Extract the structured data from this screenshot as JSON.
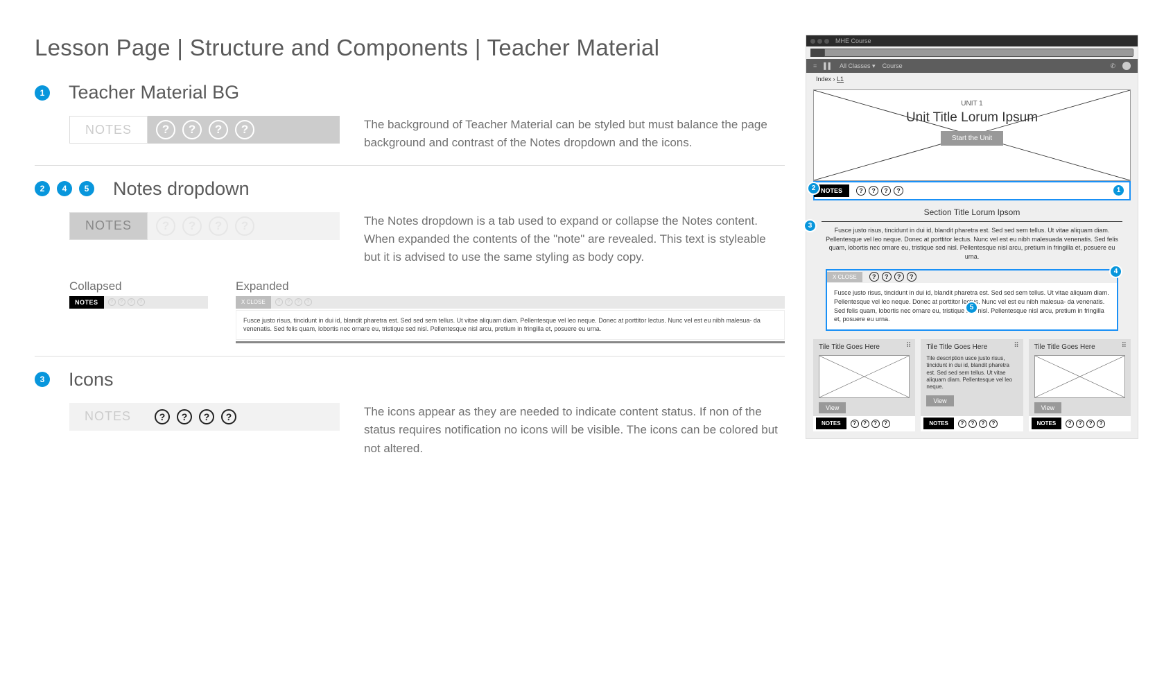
{
  "title": "Lesson Page |  Structure and Components | Teacher Material",
  "sections": [
    {
      "badges": [
        "1"
      ],
      "title": "Teacher Material BG",
      "notes_label": "NOTES",
      "desc": "The background of Teacher Material can be styled but must balance the page background and contrast of the Notes dropdown and the icons."
    },
    {
      "badges": [
        "2",
        "4",
        "5"
      ],
      "title": "Notes dropdown",
      "notes_label": "NOTES",
      "desc": "The Notes dropdown is a tab used to expand or collapse the Notes content. When expanded the contents of the \"note\" are revealed. This text is styleable but it is advised to use the same styling as body copy.",
      "collapsed_label": "Collapsed",
      "expanded_label": "Expanded",
      "mini_notes": "NOTES",
      "mini_close": "X  CLOSE",
      "mini_body": "Fusce justo risus, tincidunt in dui id, blandit pharetra est. Sed sed sem tellus. Ut vitae aliquam diam. Pellentesque vel leo neque. Donec at porttitor lectus. Nunc vel est eu nibh malesua- da venenatis. Sed felis quam, lobortis nec ornare eu, tristique sed nisl. Pellentesque nisl arcu, pretium in fringilla et, posuere eu urna."
    },
    {
      "badges": [
        "3"
      ],
      "title": "Icons",
      "notes_label": "NOTES",
      "desc": "The icons appear as they are needed to indicate content status. If non of the status requires notification no icons will be visible. The icons can be colored but not altered."
    }
  ],
  "mock": {
    "app_title": "MHE Course",
    "toolbar": {
      "classes": "All Classes  ▾",
      "course": "Course"
    },
    "crumb_index": "Index",
    "crumb_l1": "L1",
    "unit_label": "UNIT 1",
    "unit_title": "Unit Title Lorum Ipsum",
    "start_btn": "Start the Unit",
    "section_title": "Section Title Lorum Ipsom",
    "body": "Fusce justo risus, tincidunt in dui id, blandit pharetra est. Sed sed sem tellus. Ut vitae aliquam diam. Pellentesque vel leo neque. Donec at porttitor lectus. Nunc vel est eu nibh malesuada venenatis. Sed felis quam, lobortis nec ornare eu, tristique sed nisl. Pellentesque nisl arcu, pretium in fringilla et, posuere eu urna.",
    "notes_label": "NOTES",
    "close_label": "X  CLOSE",
    "note_body": "Fusce justo risus, tincidunt in dui id, blandit pharetra est. Sed sed sem tellus. Ut vitae aliquam diam. Pellentesque vel leo neque. Donec at porttitor lectus. Nunc vel est eu nibh malesua- da venenatis. Sed felis quam, lobortis nec ornare eu, tristique sed nisl. Pellentesque nisl arcu, pretium in fringilla et, posuere eu urna.",
    "tile_title": "Tile Title Goes Here",
    "tile_desc": "Tile description usce justo risus, tincidunt in dui id, blandit pharetra est. Sed sed sem tellus. Ut vitae aliquam diam. Pellentesque vel leo neque.",
    "view": "View",
    "pins": {
      "p1": "1",
      "p2": "2",
      "p3": "3",
      "p4": "4",
      "p5": "5"
    }
  }
}
